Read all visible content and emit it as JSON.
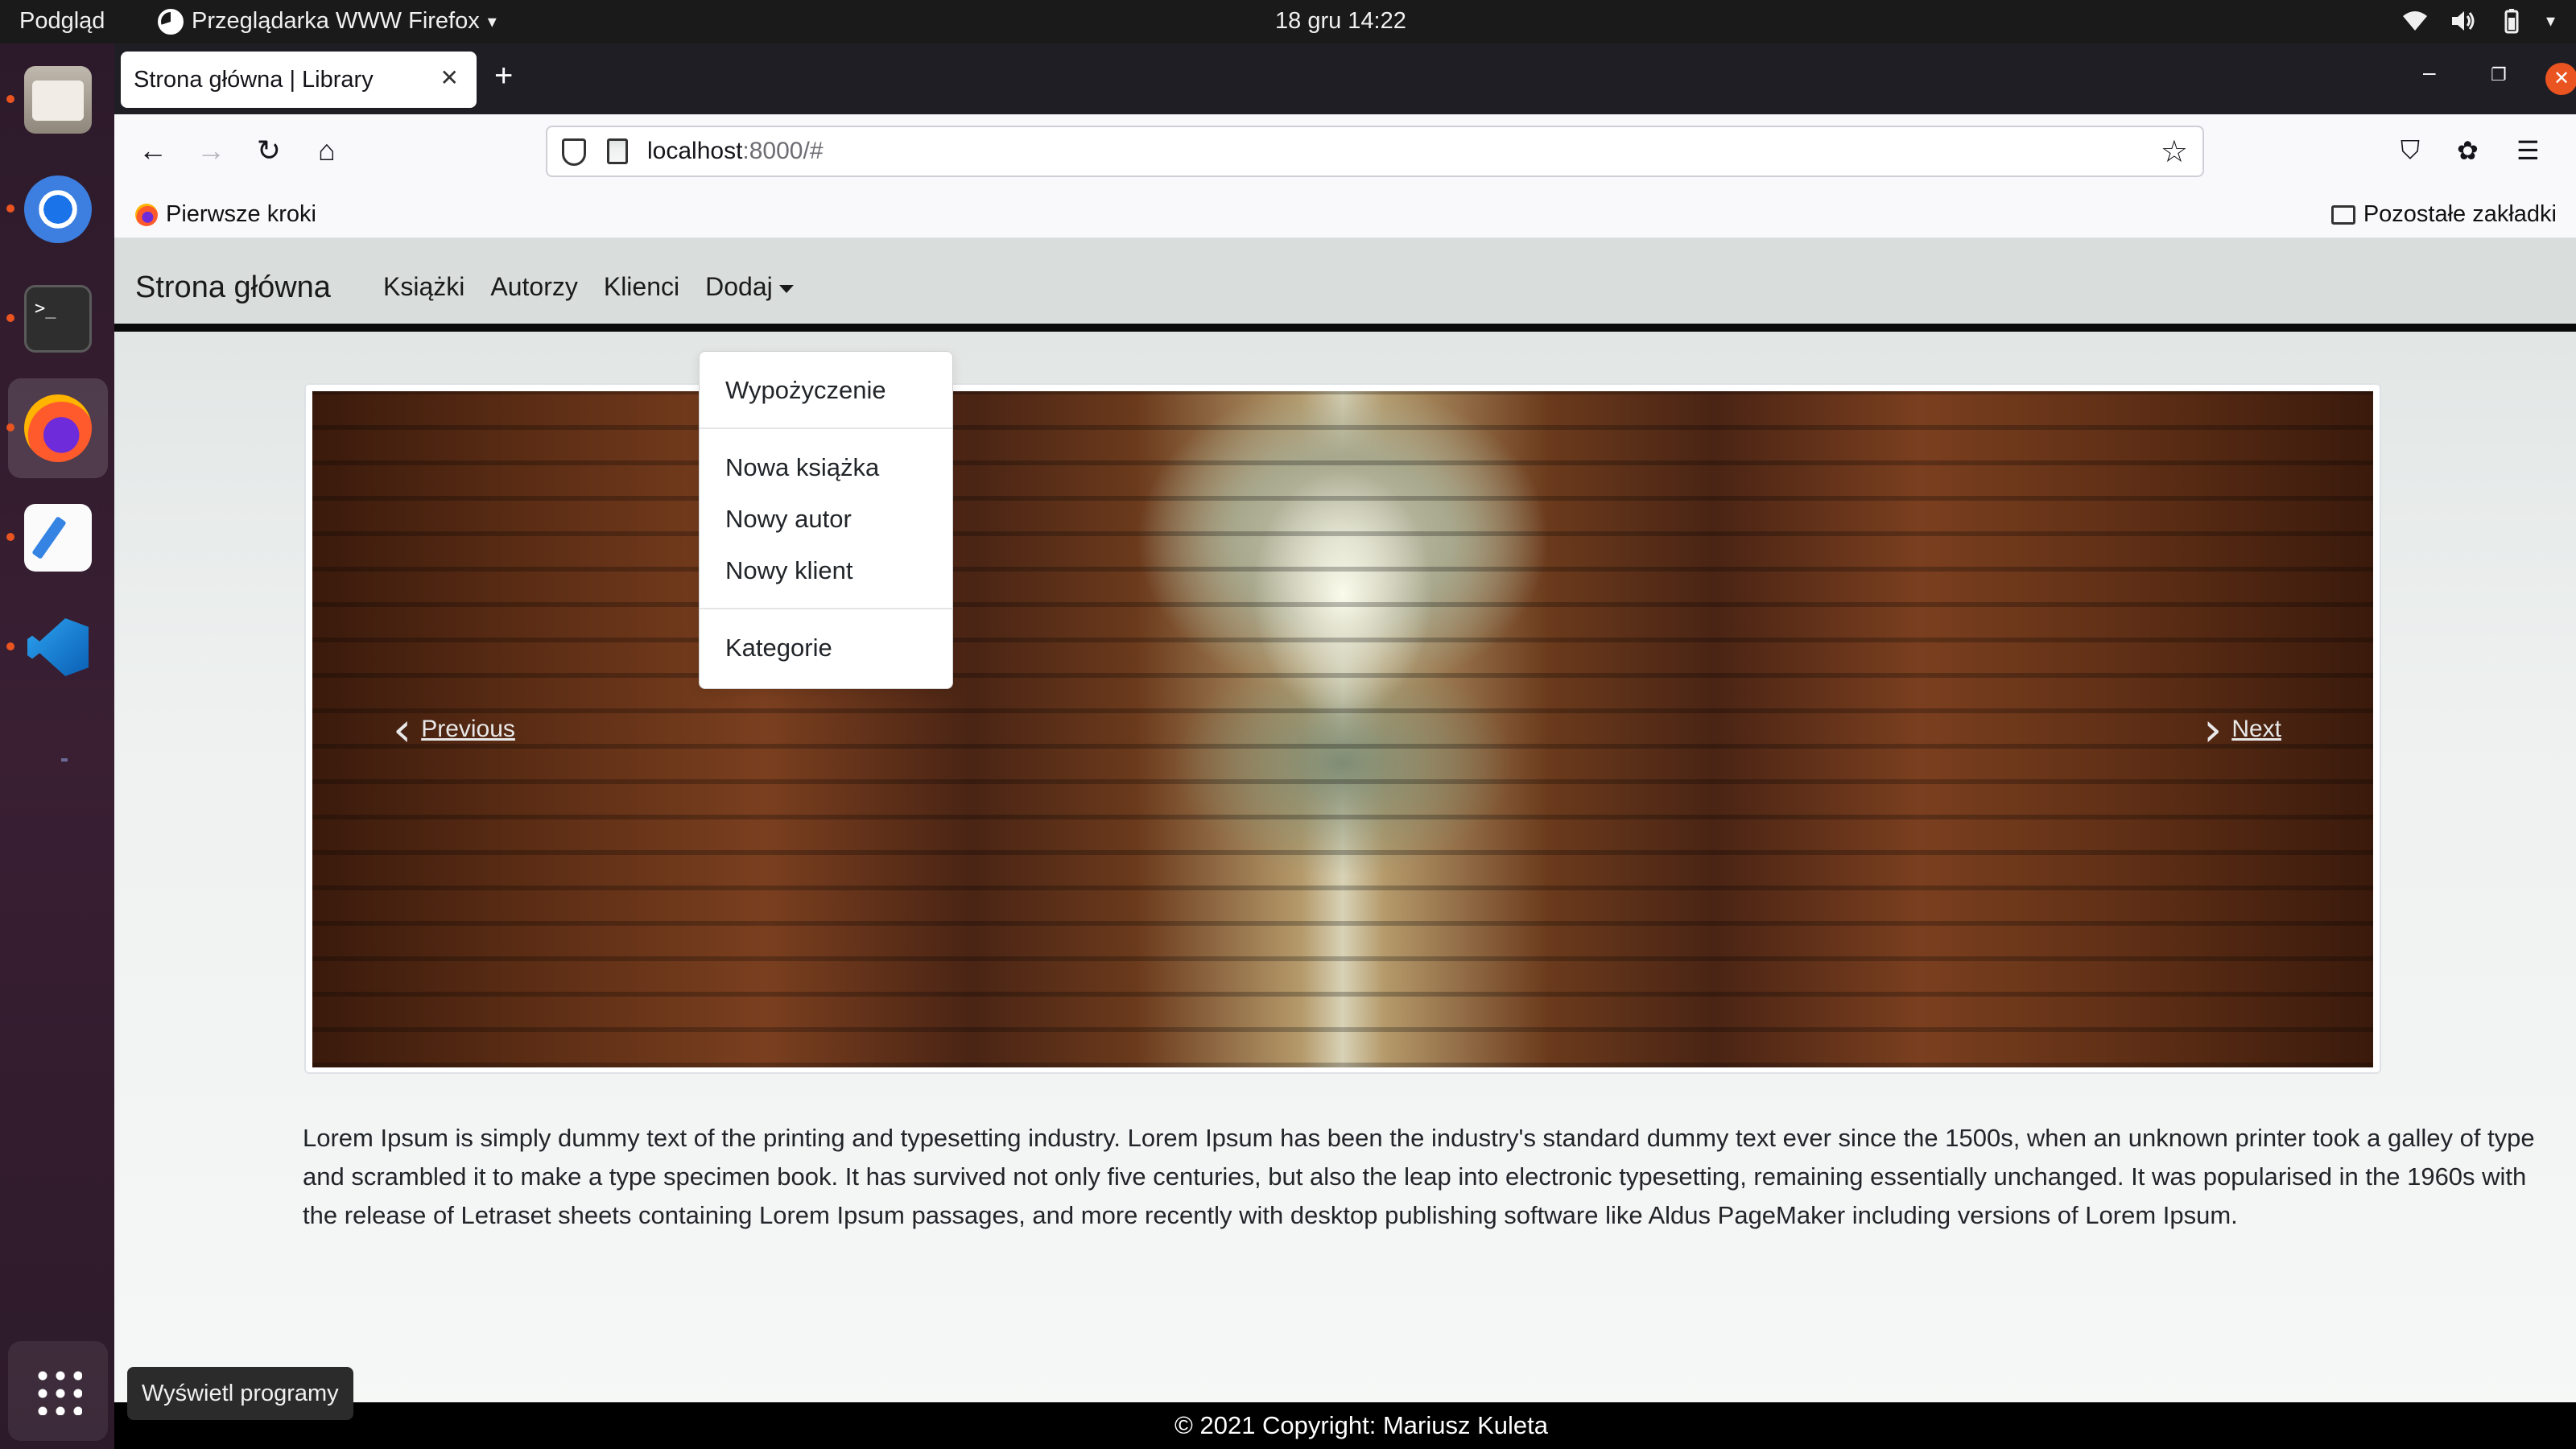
{
  "topbar": {
    "activities": "Podgląd",
    "app_name": "Przeglądarka WWW Firefox",
    "clock": "18 gru  14:22"
  },
  "dock": {
    "tooltip": "Wyświetl programy"
  },
  "browser": {
    "tab_title": "Strona główna | Library",
    "url_host": "localhost",
    "url_rest": ":8000/#",
    "bookmark_left": "Pierwsze kroki",
    "bookmark_right": "Pozostałe zakładki"
  },
  "site": {
    "brand": "Strona główna",
    "nav": {
      "books": "Książki",
      "authors": "Autorzy",
      "clients": "Klienci",
      "add": "Dodaj"
    },
    "dropdown": {
      "rental": "Wypożyczenie",
      "new_book": "Nowa książka",
      "new_author": "Nowy autor",
      "new_client": "Nowy klient",
      "categories": "Kategorie"
    },
    "carousel": {
      "prev": "Previous",
      "next": "Next"
    },
    "lorem": "Lorem Ipsum is simply dummy text of the printing and typesetting industry. Lorem Ipsum has been the industry's standard dummy text ever since the 1500s, when an unknown printer took a galley of type and scrambled it to make a type specimen book. It has survived not only five centuries, but also the leap into electronic typesetting, remaining essentially unchanged. It was popularised in the 1960s with the release of Letraset sheets containing Lorem Ipsum passages, and more recently with desktop publishing software like Aldus PageMaker including versions of Lorem Ipsum.",
    "footer": "© 2021 Copyright: Mariusz Kuleta"
  },
  "colors": {
    "accent": "#e95420",
    "navbar_bg": "#d9dedd",
    "footer_bg": "#000000"
  }
}
